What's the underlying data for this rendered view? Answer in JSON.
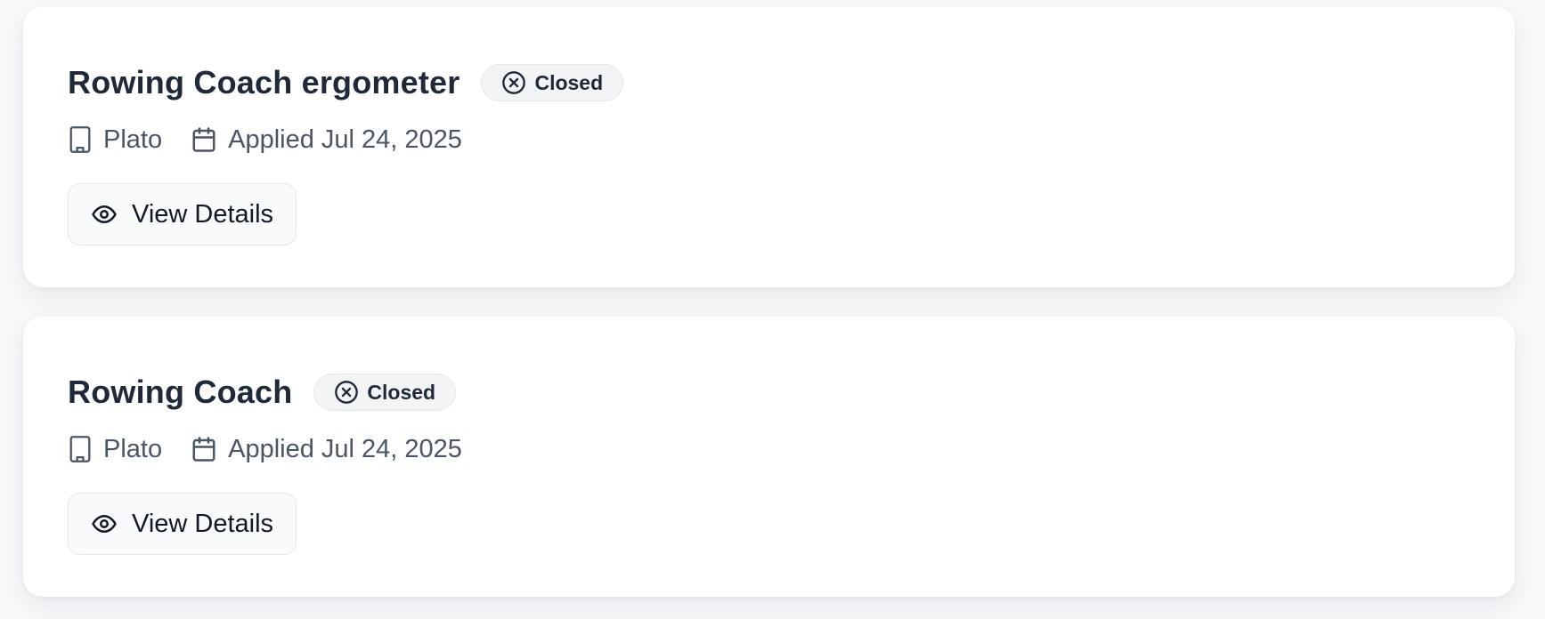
{
  "applications": [
    {
      "title": "Rowing Coach ergometer",
      "status": "Closed",
      "status_icon": "x-circle-icon",
      "company": "Plato",
      "company_icon": "building-icon",
      "applied": "Applied Jul 24, 2025",
      "applied_icon": "calendar-icon",
      "action_label": "View Details",
      "action_icon": "eye-icon"
    },
    {
      "title": "Rowing Coach",
      "status": "Closed",
      "status_icon": "x-circle-icon",
      "company": "Plato",
      "company_icon": "building-icon",
      "applied": "Applied Jul 24, 2025",
      "applied_icon": "calendar-icon",
      "action_label": "View Details",
      "action_icon": "eye-icon"
    }
  ],
  "colors": {
    "title": "#1f2937",
    "meta": "#4b5563",
    "badge_bg": "#f3f4f6",
    "card_bg": "#ffffff",
    "page_bg": "#f8f9fb"
  }
}
